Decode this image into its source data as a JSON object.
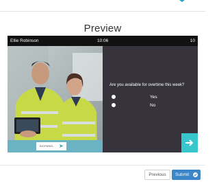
{
  "page": {
    "title": "Preview"
  },
  "preview": {
    "status_bar": {
      "name": "Ellie Robinson",
      "time": "10:06",
      "count": "10"
    },
    "question": "Are you available for overtime this week?",
    "options": [
      {
        "label": "Yes"
      },
      {
        "label": "No"
      }
    ],
    "logo_text": "BIOPANEL"
  },
  "footer": {
    "previous_label": "Previous",
    "submit_label": "Submit"
  },
  "colors": {
    "accent": "#2aa7c2",
    "submit": "#3a86c8",
    "next_tab": "#36c6cc",
    "panel": "#36333d"
  },
  "icons": {
    "next": "arrow-right-icon",
    "submit": "check-circle-icon",
    "logo": "logo-mark-icon"
  }
}
